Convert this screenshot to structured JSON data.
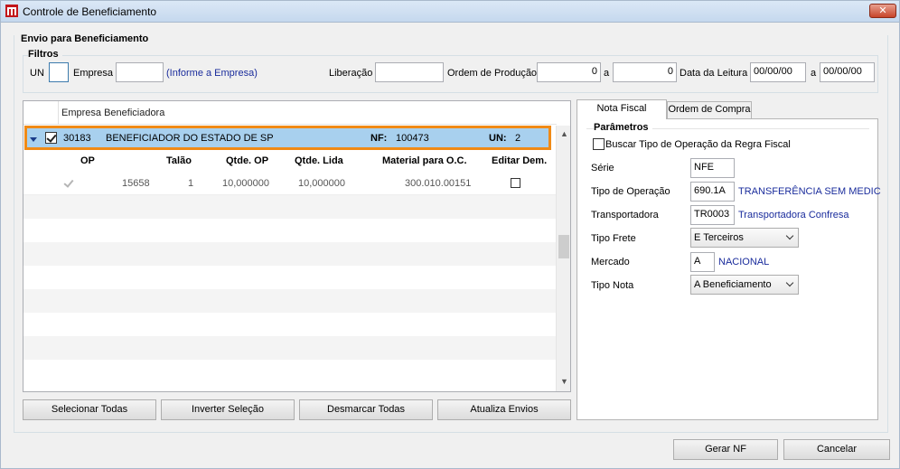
{
  "window": {
    "title": "Controle de Beneficiamento",
    "close_label": "✕"
  },
  "envio": {
    "group_title": "Envio para Beneficiamento"
  },
  "filtros": {
    "group_title": "Filtros",
    "un_label": "UN",
    "un_value": "",
    "empresa_label": "Empresa",
    "empresa_value": "",
    "empresa_hint": "(Informe a Empresa)",
    "liberacao_label": "Liberação",
    "liberacao_value": "",
    "ordem_producao_label": "Ordem de Produção",
    "op_from": "0",
    "op_a_label": "a",
    "op_to": "0",
    "data_leitura_label": "Data da Leitura",
    "data_from": "00/00/00",
    "data_a_label": "a",
    "data_to": "00/00/00"
  },
  "grid": {
    "header": "Empresa Beneficiadora",
    "master": {
      "code": "30183",
      "name": "BENEFICIADOR DO ESTADO DE SP",
      "nf_label": "NF:",
      "nf_value": "100473",
      "un_label": "UN:",
      "un_value": "2",
      "checked": true
    },
    "columns": [
      "OP",
      "Talão",
      "Qtde. OP",
      "Qtde. Lida",
      "Material para O.C.",
      "Editar Dem."
    ],
    "rows": [
      {
        "op": "15658",
        "talao": "1",
        "qtde_op": "10,000000",
        "qtde_lida": "10,000000",
        "material": "300.010.00151",
        "checked": true,
        "editar": false
      }
    ]
  },
  "buttons": {
    "selecionar_todas": "Selecionar Todas",
    "inverter_selecao": "Inverter Seleção",
    "desmarcar_todas": "Desmarcar Todas",
    "atualiza_envios": "Atualiza Envios",
    "gerar_nf": "Gerar NF",
    "cancelar": "Cancelar"
  },
  "tabs": {
    "nota_fiscal": "Nota Fiscal",
    "ordem_compra": "Ordem de Compra",
    "active": "Nota Fiscal"
  },
  "parametros": {
    "title": "Parâmetros",
    "buscar_label": "Buscar Tipo de Operação da Regra Fiscal",
    "serie_label": "Série",
    "serie_value": "NFE",
    "tipo_operacao_label": "Tipo de Operação",
    "tipo_operacao_code": "690.1A",
    "tipo_operacao_desc": "TRANSFERÊNCIA SEM MEDIC",
    "transportadora_label": "Transportadora",
    "transportadora_code": "TR0003",
    "transportadora_desc": "Transportadora Confresa",
    "tipo_frete_label": "Tipo Frete",
    "tipo_frete_value": "E Terceiros",
    "mercado_label": "Mercado",
    "mercado_code": "A",
    "mercado_desc": "NACIONAL",
    "tipo_nota_label": "Tipo Nota",
    "tipo_nota_value": "A Beneficiamento"
  },
  "colors": {
    "selection": "#a8d0ee",
    "highlight_border": "#f08a16",
    "link_blue": "#1a2c9c"
  }
}
